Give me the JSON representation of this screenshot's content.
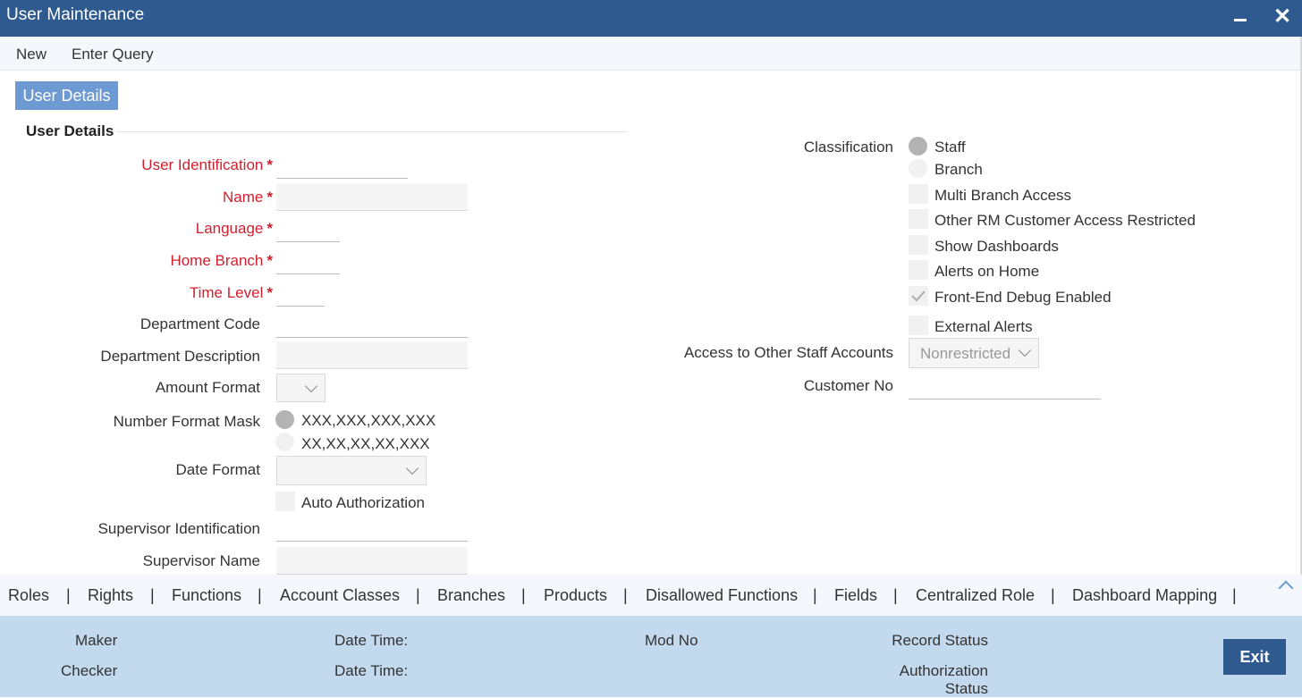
{
  "window": {
    "title": "User Maintenance"
  },
  "toolbar": {
    "new_label": "New",
    "enter_query_label": "Enter Query"
  },
  "tab": {
    "label": "User Details"
  },
  "section": {
    "title": "User Details"
  },
  "fields": {
    "user_identification": "User Identification",
    "name": "Name",
    "language": "Language",
    "home_branch": "Home Branch",
    "time_level": "Time Level",
    "department_code": "Department Code",
    "department_description": "Department Description",
    "amount_format": "Amount Format",
    "number_format_mask": "Number Format Mask",
    "date_format": "Date Format",
    "supervisor_identification": "Supervisor Identification",
    "supervisor_name": "Supervisor Name",
    "classification": "Classification",
    "access_other_staff": "Access to Other Staff Accounts",
    "customer_no": "Customer No"
  },
  "required_mark": "*",
  "options": {
    "number_mask_1": "XXX,XXX,XXX,XXX",
    "number_mask_2": "XX,XX,XX,XX,XXX",
    "auto_authorization": "Auto Authorization",
    "staff": "Staff",
    "branch": "Branch",
    "multi_branch_access": "Multi Branch Access",
    "other_rm_restricted": "Other RM Customer Access Restricted",
    "show_dashboards": "Show Dashboards",
    "alerts_on_home": "Alerts on Home",
    "front_end_debug": "Front-End Debug Enabled",
    "external_alerts": "External Alerts",
    "access_value": "Nonrestricted"
  },
  "bottom_links": [
    "Roles",
    "Rights",
    "Functions",
    "Account Classes",
    "Branches",
    "Products",
    "Disallowed Functions",
    "Fields",
    "Centralized Role",
    "Dashboard Mapping"
  ],
  "separator": "|",
  "footer": {
    "maker": "Maker",
    "checker": "Checker",
    "date_time_1": "Date Time:",
    "date_time_2": "Date Time:",
    "mod_no": "Mod No",
    "record_status": "Record Status",
    "authorization_status": "Authorization",
    "authorization_status_2": "Status",
    "exit_label": "Exit"
  },
  "colors": {
    "title_bar": "#2e5a8f",
    "tab": "#6e9ad3",
    "footer": "#c2d9ee",
    "required": "#d0202e"
  }
}
